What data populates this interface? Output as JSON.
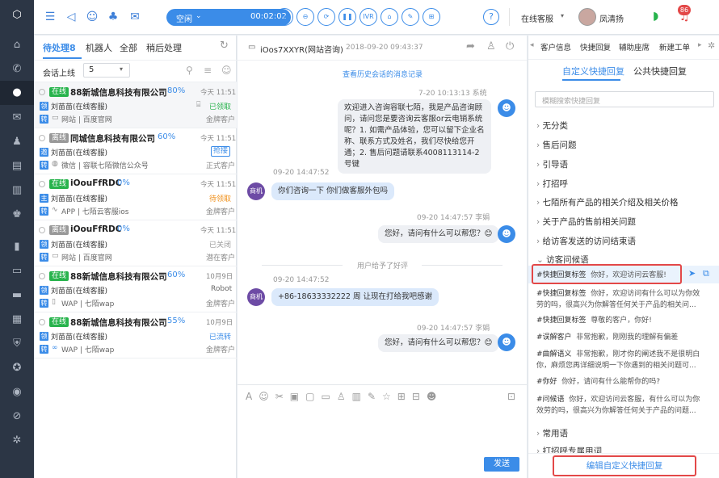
{
  "nav": {
    "icons": [
      "logo-icon",
      "home-icon",
      "phone-icon",
      "chat-icon",
      "mail-icon",
      "user-icon",
      "clipboard-icon",
      "book-icon",
      "people-icon",
      "stats-icon",
      "monitor-icon",
      "screen-icon",
      "calendar-icon",
      "shield-icon",
      "star-icon",
      "bubble-icon",
      "link-icon",
      "gear-icon"
    ]
  },
  "topbar": {
    "status": "空闲",
    "timer": "00:02:02",
    "ivr": "IVR",
    "service": "在线客服",
    "username": "凤清扬",
    "notify": "86"
  },
  "convs": {
    "tabs": [
      "待处理8",
      "机器人",
      "全部",
      "稍后处理"
    ],
    "limit_label": "会话上线",
    "limit_value": "5",
    "items": [
      {
        "status": "在线",
        "status_color": "#27b34c",
        "name": "88新城信息科技有限公司",
        "pct": "80%",
        "time": "今天 11:51",
        "agent_icon": "领",
        "agent": "刘苗苗(在线客服)",
        "state": "已领取",
        "state_color": "#27b34c",
        "ch_icon": "转",
        "channel": "网站 | 百度官网",
        "tag": "金牌客户"
      },
      {
        "status": "离线",
        "status_color": "#999999",
        "name": "同城信息科技有限公司",
        "pct": "60%",
        "time": "今天 11:51",
        "agent_icon": "邀",
        "agent": "刘苗苗(在线客服)",
        "state": "抢接",
        "state_color": "#3b8ce8",
        "ch_icon": "转",
        "channel": "微信 | 容联七陌微信公众号",
        "tag": "正式客户"
      },
      {
        "status": "在线",
        "status_color": "#27b34c",
        "name": "iOouFfRDC",
        "pct": "0%",
        "time": "今天 11:51",
        "agent_icon": "主",
        "agent": "刘苗苗(在线客服)",
        "state": "待领取",
        "state_color": "#f0901a",
        "ch_icon": "转",
        "channel": "APP | 七陌云客服ios",
        "tag": "金牌客户"
      },
      {
        "status": "离线",
        "status_color": "#999999",
        "name": "iOouFfRDC",
        "pct": "0%",
        "time": "今天 11:51",
        "agent_icon": "领",
        "agent": "刘苗苗(在线客服)",
        "state": "已关闭",
        "state_color": "#999999",
        "ch_icon": "转",
        "channel": "网站 | 百度官网",
        "tag": "潜在客户"
      },
      {
        "status": "在线",
        "status_color": "#27b34c",
        "name": "88新城信息科技有限公司",
        "pct": "60%",
        "time": "10月9日",
        "agent_icon": "领",
        "agent": "刘苗苗(在线客服)",
        "state": "Robot",
        "state_color": "#666666",
        "ch_icon": "转",
        "channel": "WAP | 七陌wap",
        "tag": "金牌客户"
      },
      {
        "status": "在线",
        "status_color": "#27b34c",
        "name": "88新城信息科技有限公司",
        "pct": "55%",
        "time": "10月9日",
        "agent_icon": "领",
        "agent": "刘苗苗(在线客服)",
        "state": "已流转",
        "state_color": "#3b8ce8",
        "ch_icon": "转",
        "channel": "WAP | 七陌wap",
        "tag": "金牌客户"
      }
    ]
  },
  "chat": {
    "header": "iOos7XXYR(网站咨询)",
    "header_time": "2018-09-20 09:43:37",
    "history_link": "查看历史会话的消息记录",
    "msg1_meta": "7-20  10:13:13  系统",
    "msg1": "欢迎进入咨询容联七陌，我是产品咨询顾问，请问您是要咨询云客服or云电销系统呢？1. 如需产品体验，您可以留下企业名称、联系方式及姓名，我们尽快给您开通；2. 售后问题请联系4008113114-2号键",
    "msg2_meta": "09-20 14:47:52",
    "msg2": "你们咨询一下 你们做客服外包吗",
    "msg3_meta": "09-20 14:47:57  李娟",
    "msg3": "您好，请问有什么可以帮您？😊",
    "rating": "用户给予了好评",
    "msg4_meta": "09-20 14:47:52",
    "msg4": "+86-18633332222 周 让现在打给我吧感谢",
    "msg5_meta": "09-20 14:47:57  李娟",
    "msg5": "您好，请问有什么可以帮您？😊",
    "agent_avatar": "商机",
    "send": "发送"
  },
  "right": {
    "tabs": [
      "客户信息",
      "快捷回复",
      "辅助座席",
      "新建工单"
    ],
    "subtabs": [
      "自定义快捷回复",
      "公共快捷回复"
    ],
    "search_placeholder": "模糊搜索快捷回复",
    "categories": [
      "无分类",
      "售后问题",
      "引导语",
      "打招呼",
      "七陌所有产品的相关介绍及相关价格",
      "关于产品的售前相关问题",
      "给访客发送的访问结束语",
      "访客问候语"
    ],
    "replies": [
      {
        "tag": "#快捷回复标签",
        "text": "你好，欢迎访问云客服!"
      },
      {
        "tag": "#快捷回复标签",
        "text": "你好，欢迎访问有什么可以为你效劳的吗，很高兴为你解答任何关于产品的相关问..."
      },
      {
        "tag": "#快捷回复标签",
        "text": "尊敬的客户，你好!"
      },
      {
        "tag": "#误解客户",
        "text": "非常抱歉，刚刚我的理解有偏差"
      },
      {
        "tag": "#曲解语义",
        "text": "非常抱歉，刚才你的阐述我不是很明白你，麻烦您再详细说明一下你遇到的相关问题可..."
      },
      {
        "tag": "#你好",
        "text": "你好，请问有什么能帮你的吗?"
      },
      {
        "tag": "#问候语",
        "text": "你好，欢迎访问云客服，有什么可以为你效劳的吗，很高兴为你解答任何关于产品的问题..."
      }
    ],
    "after": [
      "常用语",
      "打招呼专属用词"
    ],
    "edit_button": "编辑自定义快捷回复"
  }
}
